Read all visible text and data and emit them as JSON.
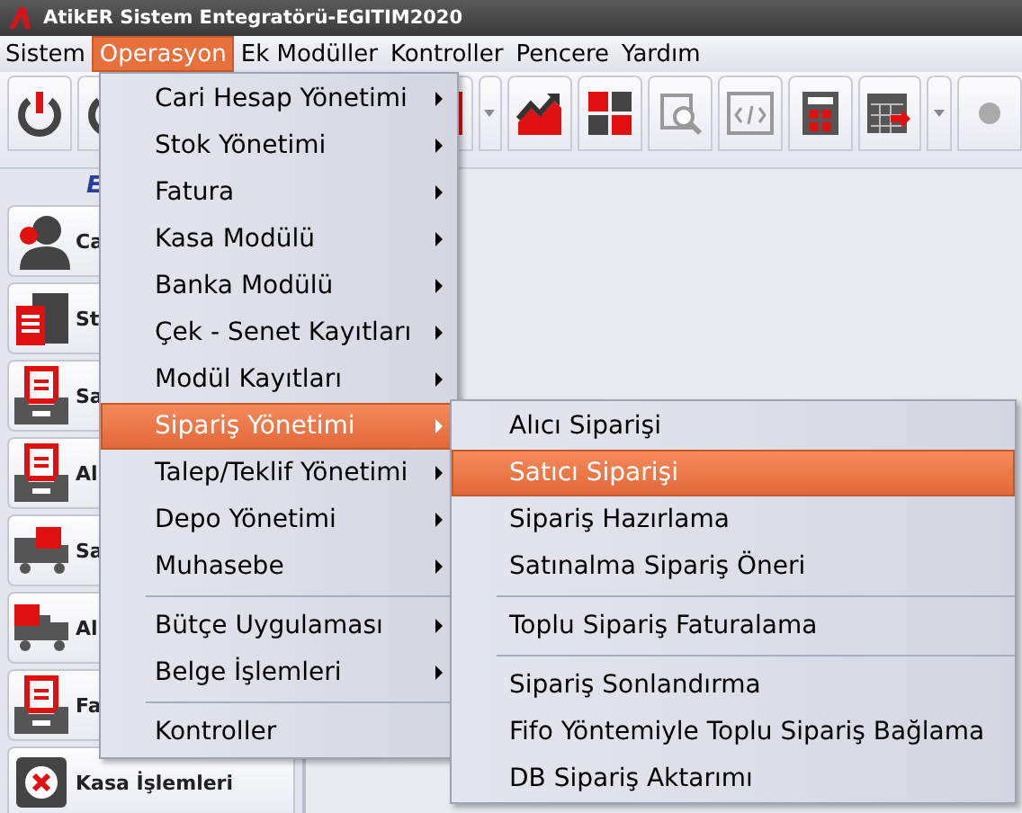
{
  "window": {
    "title": "AtikER Sistem Entegratörü-EGITIM2020"
  },
  "menubar": [
    {
      "label": "Sistem",
      "selected": false
    },
    {
      "label": "Operasyon",
      "selected": true
    },
    {
      "label": "Ek Modüller",
      "selected": false
    },
    {
      "label": "Kontroller",
      "selected": false
    },
    {
      "label": "Pencere",
      "selected": false
    },
    {
      "label": "Yardım",
      "selected": false
    }
  ],
  "sidebar": {
    "header": "E",
    "items": [
      {
        "label": "Ca"
      },
      {
        "label": "St"
      },
      {
        "label": "Sa"
      },
      {
        "label": "Al"
      },
      {
        "label": "Sa"
      },
      {
        "label": "Al"
      },
      {
        "label": "Fa"
      },
      {
        "label": "Kasa İşlemleri"
      }
    ]
  },
  "menu": [
    {
      "kind": "item",
      "label": "Cari Hesap Yönetimi",
      "submenu": true,
      "selected": false
    },
    {
      "kind": "item",
      "label": "Stok Yönetimi",
      "submenu": true,
      "selected": false
    },
    {
      "kind": "item",
      "label": "Fatura",
      "submenu": true,
      "selected": false
    },
    {
      "kind": "item",
      "label": "Kasa Modülü",
      "submenu": true,
      "selected": false
    },
    {
      "kind": "item",
      "label": "Banka Modülü",
      "submenu": true,
      "selected": false
    },
    {
      "kind": "item",
      "label": "Çek - Senet Kayıtları",
      "submenu": true,
      "selected": false
    },
    {
      "kind": "item",
      "label": "Modül Kayıtları",
      "submenu": true,
      "selected": false
    },
    {
      "kind": "item",
      "label": "Sipariş Yönetimi",
      "submenu": true,
      "selected": true
    },
    {
      "kind": "item",
      "label": "Talep/Teklif Yönetimi",
      "submenu": true,
      "selected": false
    },
    {
      "kind": "item",
      "label": "Depo Yönetimi",
      "submenu": true,
      "selected": false
    },
    {
      "kind": "item",
      "label": "Muhasebe",
      "submenu": true,
      "selected": false
    },
    {
      "kind": "separator"
    },
    {
      "kind": "item",
      "label": "Bütçe Uygulaması",
      "submenu": true,
      "selected": false
    },
    {
      "kind": "item",
      "label": "Belge İşlemleri",
      "submenu": true,
      "selected": false
    },
    {
      "kind": "separator"
    },
    {
      "kind": "item",
      "label": "Kontroller",
      "submenu": false,
      "selected": false
    }
  ],
  "submenu": [
    {
      "kind": "item",
      "label": "Alıcı Siparişi",
      "selected": false
    },
    {
      "kind": "item",
      "label": "Satıcı Siparişi",
      "selected": true
    },
    {
      "kind": "item",
      "label": "Sipariş Hazırlama",
      "selected": false
    },
    {
      "kind": "item",
      "label": "Satınalma Sipariş Öneri",
      "selected": false
    },
    {
      "kind": "separator"
    },
    {
      "kind": "item",
      "label": "Toplu Sipariş Faturalama",
      "selected": false
    },
    {
      "kind": "separator"
    },
    {
      "kind": "item",
      "label": "Sipariş Sonlandırma",
      "selected": false
    },
    {
      "kind": "item",
      "label": "Fifo Yöntemiyle Toplu Sipariş Bağlama",
      "selected": false
    },
    {
      "kind": "item",
      "label": "DB Sipariş Aktarımı",
      "selected": false
    }
  ]
}
